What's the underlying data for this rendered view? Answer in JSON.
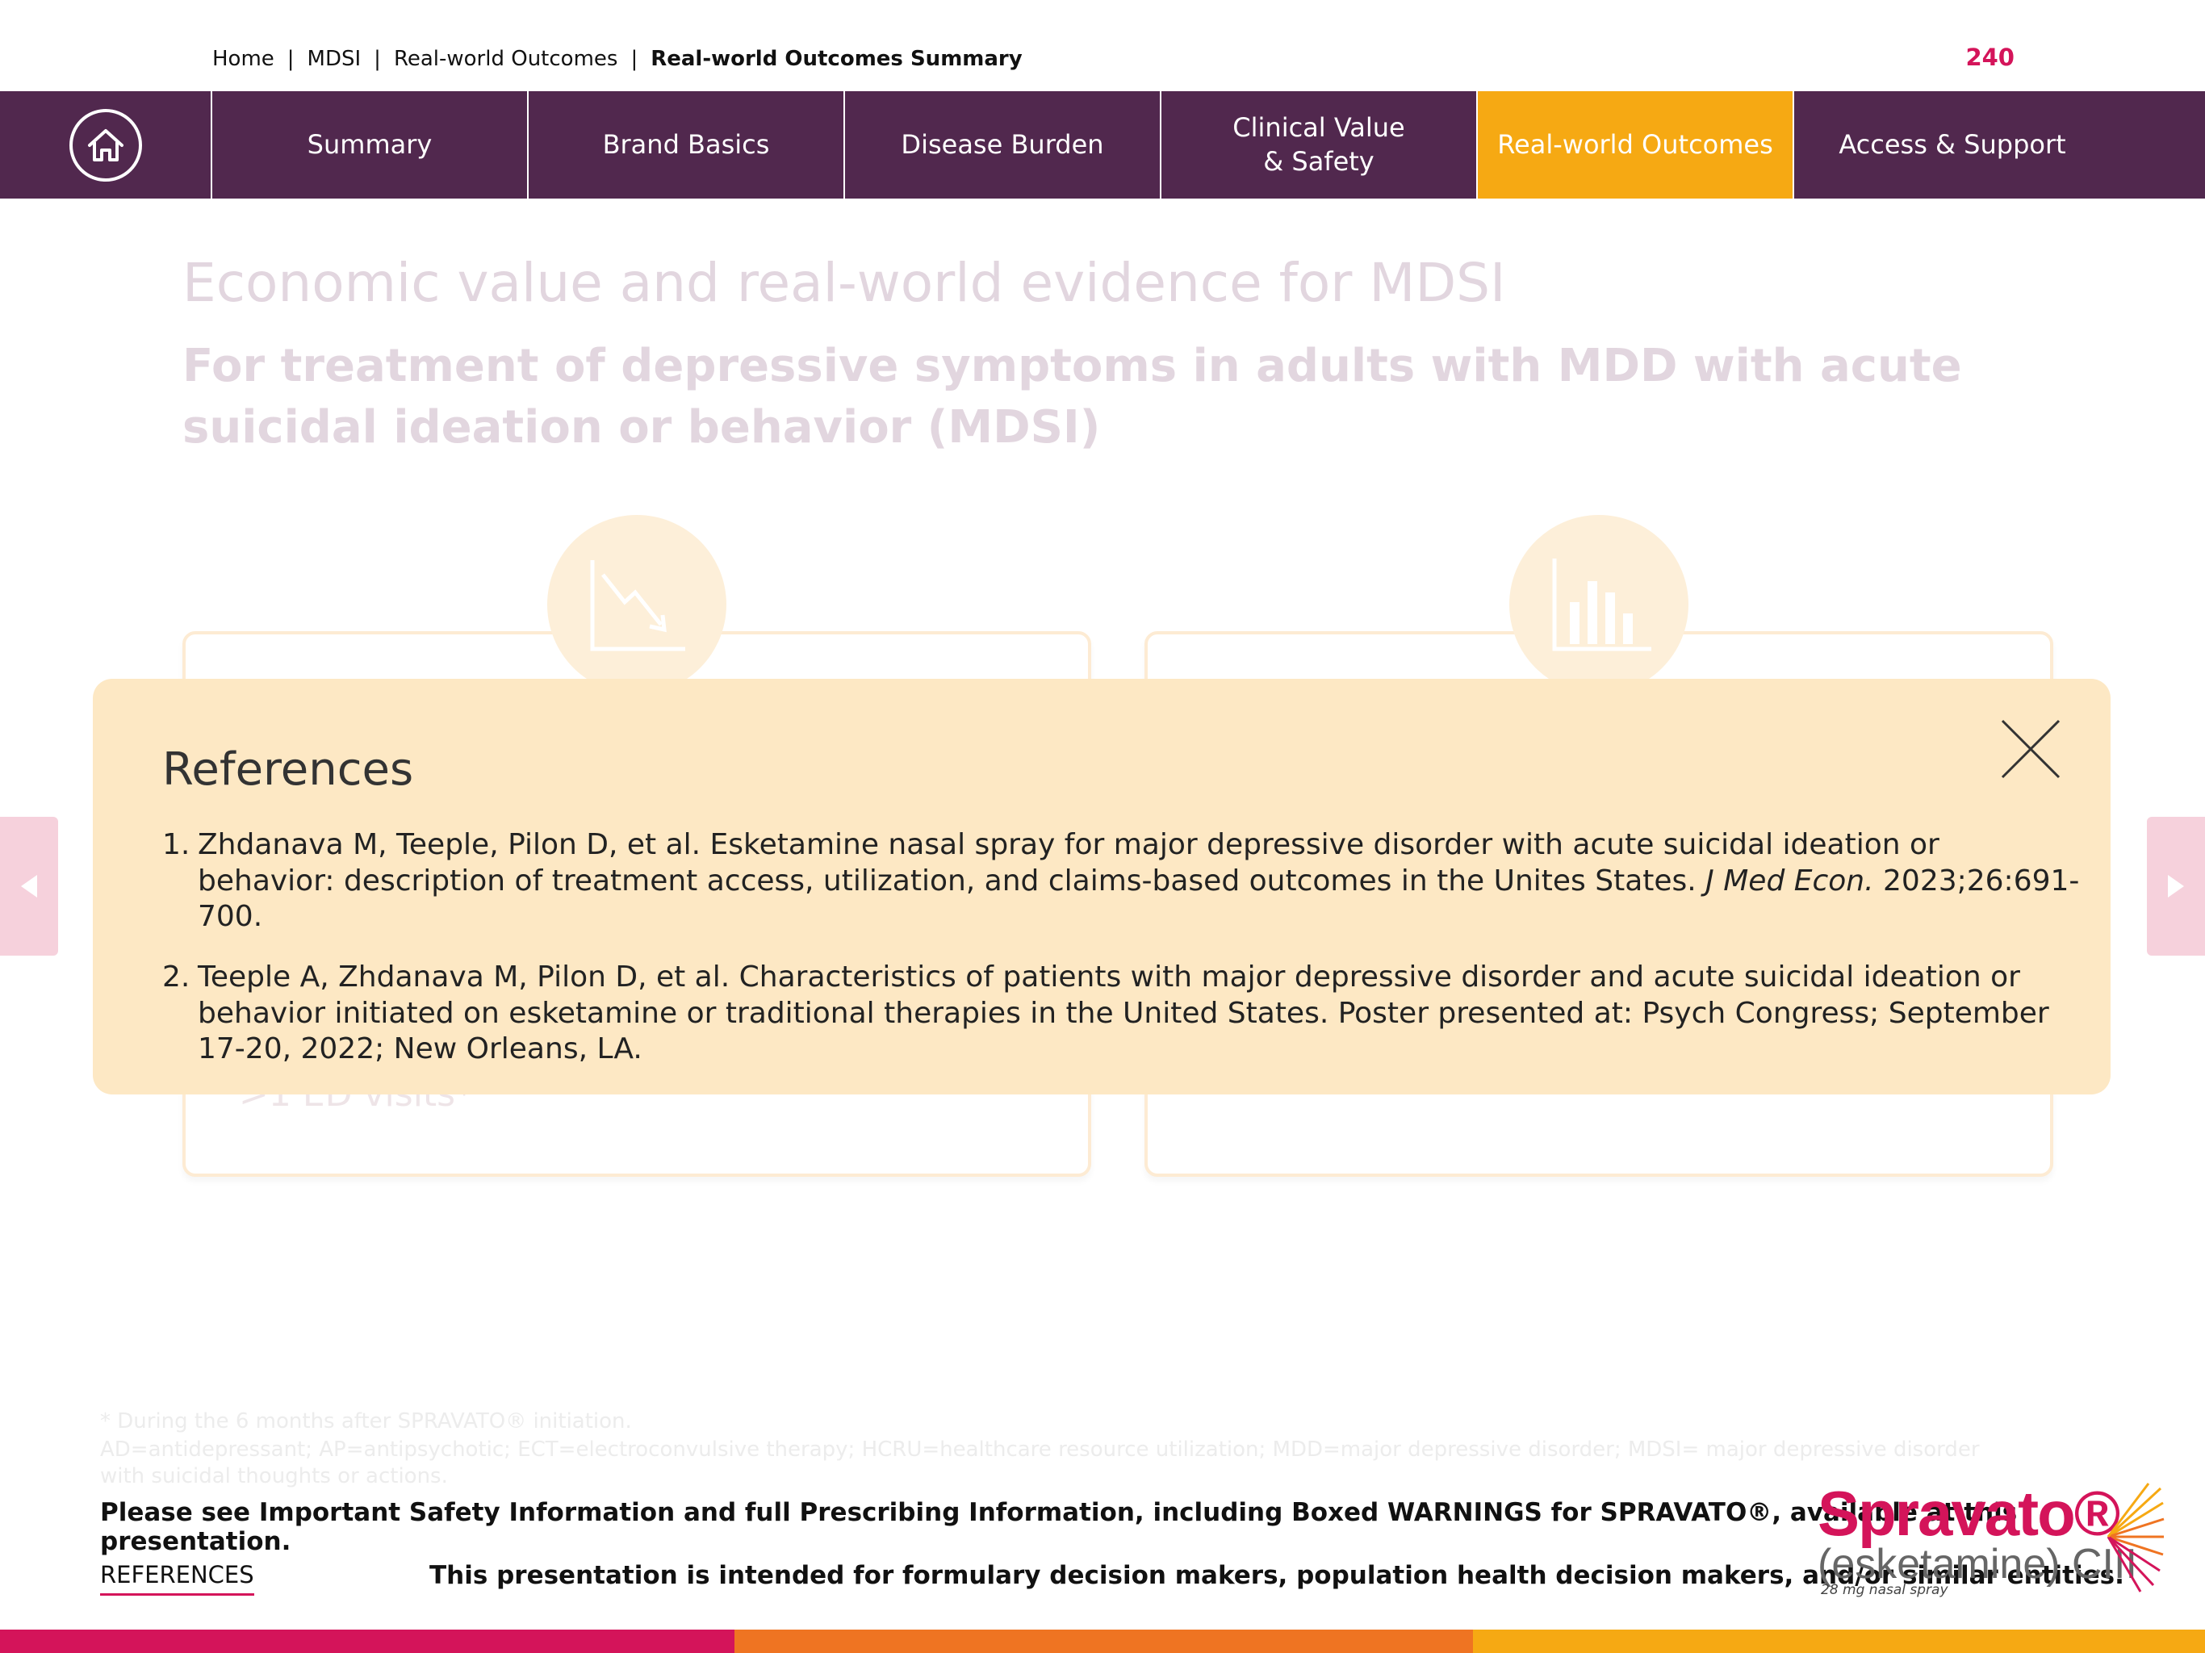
{
  "breadcrumb": {
    "items": [
      "Home",
      "MDSI",
      "Real-world Outcomes"
    ],
    "current": "Real-world Outcomes Summary",
    "separator": "|"
  },
  "page_number": "240",
  "nav": {
    "home_icon": "home-icon",
    "tabs": [
      {
        "label": "Summary",
        "active": false
      },
      {
        "label": "Brand Basics",
        "active": false
      },
      {
        "label": "Disease Burden",
        "active": false
      },
      {
        "label": "Clinical Value\n& Safety",
        "active": false
      },
      {
        "label": "Real-world Outcomes",
        "active": true
      },
      {
        "label": "Access & Support",
        "active": false
      }
    ]
  },
  "background": {
    "title": "Economic value and real-world evidence for MDSI",
    "subtitle": "For treatment of depressive symptoms in adults with MDD with acute suicidal ideation or behavior (MDSI)",
    "left_card_icon": "downtrend-chart-icon",
    "right_card_icon": "bar-chart-icon",
    "left_card_text": ">1 ED visits*"
  },
  "modal": {
    "title": "References",
    "close_icon": "close-icon",
    "references": [
      {
        "num": "1.",
        "pre": "Zhdanava M, Teeple, Pilon D, et al. Esketamine nasal spray for major depressive disorder with acute suicidal ideation or behavior: description of treatment access, utilization, and claims-based outcomes in the Unites States. ",
        "journal": "J Med Econ.",
        "post": " 2023;26:691-700."
      },
      {
        "num": "2.",
        "pre": "Teeple A, Zhdanava M, Pilon D, et al. Characteristics of patients with major depressive disorder and acute suicidal ideation or behavior initiated on esketamine or traditional therapies in the United States. Poster presented at: Psych Congress; September 17-20, 2022; New Orleans, LA.",
        "journal": "",
        "post": ""
      }
    ]
  },
  "footer": {
    "footnote": "* During the 6 months after SPRAVATO® initiation.",
    "abbreviations": "AD=antidepressant; AP=antipsychotic; ECT=electroconvulsive therapy; HCRU=healthcare resource utilization; MDD=major depressive disorder; MDSI= major depressive disorder with suicidal thoughts or actions.",
    "isi": "Please see Important Safety Information and full Prescribing Information, including Boxed WARNINGS for SPRAVATO®, available at this presentation.",
    "references_link": "REFERENCES",
    "audience": "This presentation is intended for formulary decision makers, population health decision makers, and/or similar entities."
  },
  "logo": {
    "brand": "Spravato®",
    "generic": "(esketamine) CIII",
    "dose": "28 mg nasal spray"
  },
  "colors": {
    "nav_bg": "#51284e",
    "nav_active": "#f6a913",
    "accent": "#d4145a",
    "modal_bg": "#fde8c4",
    "bar": [
      "#d4145a",
      "#ef7422",
      "#f6a913"
    ]
  }
}
